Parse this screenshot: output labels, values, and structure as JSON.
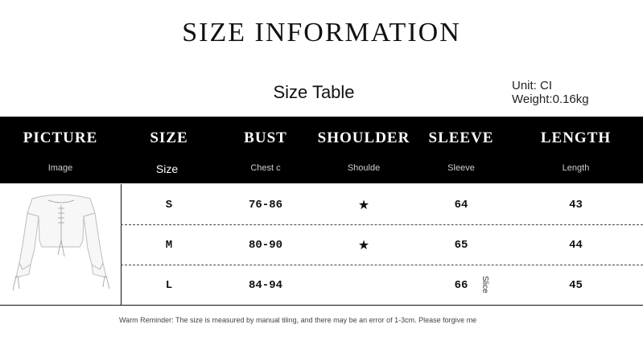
{
  "title": "SIZE INFORMATION",
  "subtitle": "Size Table",
  "unit": "Unit: CI",
  "weight": "Weight:0.16kg",
  "headers": [
    {
      "label": "PICTURE",
      "sub": "Image"
    },
    {
      "label": "SIZE",
      "sub": "Size"
    },
    {
      "label": "BUST",
      "sub": "Chest c"
    },
    {
      "label": "SHOULDER",
      "sub": "Shoulde"
    },
    {
      "label": "SLEEVE",
      "sub": "Sleeve"
    },
    {
      "label": "LENGTH",
      "sub": "Length"
    }
  ],
  "rows": [
    {
      "size": "S",
      "bust": "76-86",
      "shoulder": "★",
      "sleeve": "64",
      "length": "43"
    },
    {
      "size": "M",
      "bust": "80-90",
      "shoulder": "★",
      "sleeve": "65",
      "length": "44"
    },
    {
      "size": "L",
      "bust": "84-94",
      "shoulder": "Slice",
      "sleeve": "66",
      "length": "45"
    }
  ],
  "reminder": "Warm Reminder: The size is measured by manual tiling, and there may be an error of 1-3cm. Please forgive me"
}
